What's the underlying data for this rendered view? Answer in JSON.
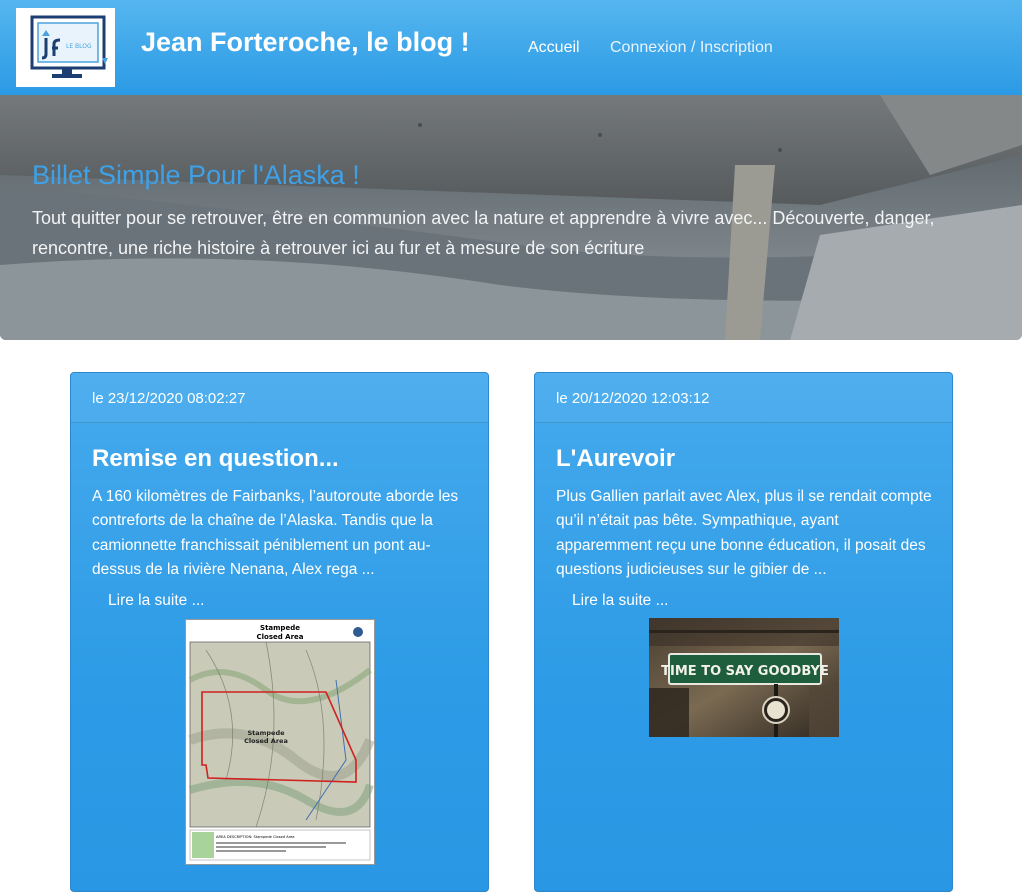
{
  "navbar": {
    "logo_text": "LE BLOG",
    "brand": "Jean Forteroche, le blog !",
    "links": [
      "Accueil",
      "Connexion / Inscription"
    ]
  },
  "hero": {
    "title": "Billet Simple Pour l'Alaska !",
    "text": "Tout quitter pour se retrouver, être en communion avec la nature et apprendre à vivre avec... Découverte, danger, rencontre, une riche histoire à retrouver ici au fur et à mesure de son écriture"
  },
  "posts": [
    {
      "date": "le 23/12/2020 08:02:27",
      "title": "Remise en question...",
      "excerpt": "A 160 kilomètres de Fairbanks, l’autoroute aborde les contreforts de la chaîne de l’Alaska. Tandis que la camionnette franchissait péniblement un pont au-dessus de la rivière Nenana, Alex rega ...",
      "more": "Lire la suite ...",
      "image": {
        "title_line1": "Stampede",
        "title_line2": "Closed Area",
        "area_label1": "Stampede",
        "area_label2": "Closed Area",
        "caption": "AREA DESCRIPTION: Stampede Closed Area"
      }
    },
    {
      "date": "le 20/12/2020 12:03:12",
      "title": "L'Aurevoir",
      "excerpt": "Plus Gallien parlait avec Alex, plus il se rendait compte qu’il n’était pas bête. Sympathique, ayant apparemment reçu une bonne éducation, il posait des questions judicieuses sur le gibier de ...",
      "more": "Lire la suite ...",
      "image": {
        "sign_text": "TIME TO SAY GOODBYE"
      }
    }
  ],
  "colors": {
    "primary": "#2b9ae5",
    "hero_title": "#3ea1e8"
  }
}
